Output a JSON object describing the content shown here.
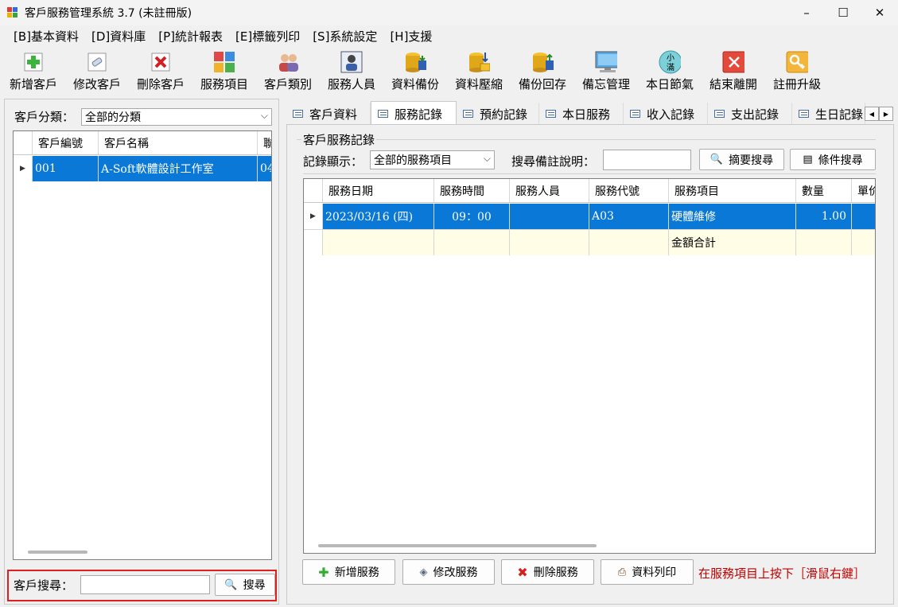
{
  "window": {
    "title": "客戶服務管理系統 3.7 (未註冊版)",
    "min_icon": "minimize-icon",
    "max_icon": "maximize-icon",
    "close_icon": "close-icon"
  },
  "menu": [
    "[B]基本資料",
    "[D]資料庫",
    "[P]統計報表",
    "[E]標籤列印",
    "[S]系統設定",
    "[H]支援"
  ],
  "toolbar": [
    {
      "label": "新增客戶",
      "icon": "add-customer-icon"
    },
    {
      "label": "修改客戶",
      "icon": "edit-customer-icon"
    },
    {
      "label": "刪除客戶",
      "icon": "delete-customer-icon"
    },
    {
      "label": "服務項目",
      "icon": "service-items-icon"
    },
    {
      "label": "客戶類別",
      "icon": "customer-category-icon"
    },
    {
      "label": "服務人員",
      "icon": "service-staff-icon"
    },
    {
      "label": "資料備份",
      "icon": "backup-icon"
    },
    {
      "label": "資料壓縮",
      "icon": "compress-icon"
    },
    {
      "label": "備份回存",
      "icon": "restore-icon"
    },
    {
      "label": "備忘管理",
      "icon": "memo-icon"
    },
    {
      "label": "本日節氣",
      "icon": "solar-term-icon"
    },
    {
      "label": "結束離開",
      "icon": "exit-icon"
    },
    {
      "label": "註冊升級",
      "icon": "register-key-icon"
    }
  ],
  "left": {
    "category_label": "客戶分類：",
    "category_value": "全部的分類",
    "columns": [
      "客戶編號",
      "客戶名稱",
      "聯"
    ],
    "rows": [
      {
        "id": "001",
        "name": "A-Soft軟體設計工作室",
        "extra": "04"
      }
    ],
    "search_label": "客戶搜尋：",
    "search_value": "",
    "search_button": "搜尋"
  },
  "tabs": [
    "客戶資料",
    "服務記錄",
    "預約記錄",
    "本日服務",
    "收入記錄",
    "支出記錄",
    "生日記錄"
  ],
  "active_tab": 1,
  "right": {
    "group_title": "客戶服務記錄",
    "filter_label": "記錄顯示：",
    "filter_value": "全部的服務項目",
    "note_search_label": "搜尋備註說明：",
    "note_search_value": "",
    "summary_search_button": "摘要搜尋",
    "condition_search_button": "條件搜尋",
    "columns": [
      "服務日期",
      "服務時間",
      "服務人員",
      "服務代號",
      "服務項目",
      "數量",
      "單价"
    ],
    "rows": [
      {
        "date": "2023/03/16 (四)",
        "time": "09：00",
        "staff": "",
        "code": "A03",
        "item": "硬體維修",
        "qty": "1.00"
      }
    ],
    "total_label": "金額合計",
    "buttons": [
      "新增服務",
      "修改服務",
      "刪除服務",
      "資料列印"
    ],
    "hint": "在服務項目上按下［滑鼠右鍵］"
  },
  "colors": {
    "selection": "#0a78d7",
    "total_row": "#fffde6",
    "hint": "#c00000",
    "highlight_border": "#e0201e"
  }
}
